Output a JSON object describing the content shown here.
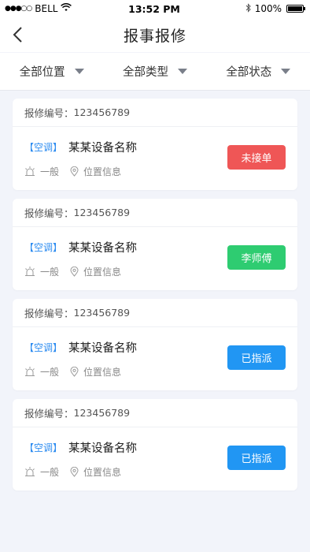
{
  "status_bar": {
    "carrier": "BELL",
    "time": "13:52 PM",
    "battery": "100%"
  },
  "nav": {
    "title": "报事报修"
  },
  "filters": [
    {
      "label": "全部位置"
    },
    {
      "label": "全部类型"
    },
    {
      "label": "全部状态"
    }
  ],
  "repairs": [
    {
      "number_label": "报修编号：",
      "number": "123456789",
      "tag": "【空调】",
      "device": "某某设备名称",
      "level": "一般",
      "location": "位置信息",
      "status": "未接单",
      "status_color": "#ef5656"
    },
    {
      "number_label": "报修编号：",
      "number": "123456789",
      "tag": "【空调】",
      "device": "某某设备名称",
      "level": "一般",
      "location": "位置信息",
      "status": "李师傅",
      "status_color": "#2ecc71"
    },
    {
      "number_label": "报修编号：",
      "number": "123456789",
      "tag": "【空调】",
      "device": "某某设备名称",
      "level": "一般",
      "location": "位置信息",
      "status": "已指派",
      "status_color": "#2196f3"
    },
    {
      "number_label": "报修编号：",
      "number": "123456789",
      "tag": "【空调】",
      "device": "某某设备名称",
      "level": "一般",
      "location": "位置信息",
      "status": "已指派",
      "status_color": "#2196f3"
    }
  ]
}
